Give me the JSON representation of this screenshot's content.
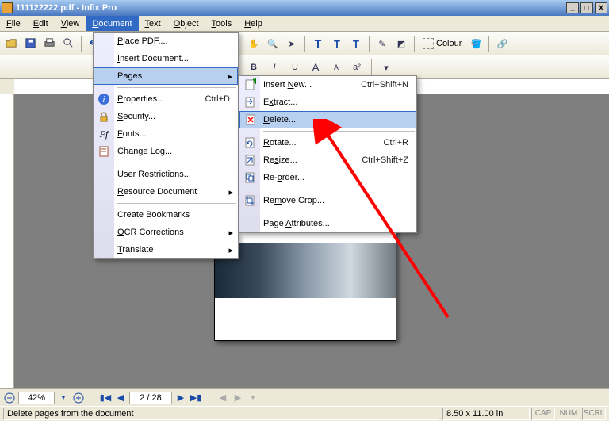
{
  "window": {
    "title": "111122222.pdf - Infix Pro",
    "btn_min": "_",
    "btn_max": "□",
    "btn_close": "X"
  },
  "menubar": [
    "File",
    "Edit",
    "View",
    "Document",
    "Text",
    "Object",
    "Tools",
    "Help"
  ],
  "open_menu_index": 3,
  "toolbar": {
    "colour_label": "Colour"
  },
  "doc_menu": {
    "items": [
      {
        "label": "Place PDF....",
        "u": 0
      },
      {
        "label": "Insert Document...",
        "u": 0
      },
      {
        "label": "Pages",
        "u": -1,
        "sub": true,
        "hl": true
      },
      {
        "div": true
      },
      {
        "label": "Properties...",
        "u": 0,
        "shortcut": "Ctrl+D",
        "icon": "info"
      },
      {
        "label": "Security...",
        "u": 0,
        "icon": "lock"
      },
      {
        "label": "Fonts...",
        "u": 0,
        "icon": "ff"
      },
      {
        "label": "Change Log...",
        "u": 0,
        "icon": "log"
      },
      {
        "div": true
      },
      {
        "label": "User Restrictions...",
        "u": 0
      },
      {
        "label": "Resource Document",
        "u": 0,
        "sub": true
      },
      {
        "div": true
      },
      {
        "label": "Create Bookmarks",
        "u": -1
      },
      {
        "label": "OCR Corrections",
        "u": 0,
        "sub": true
      },
      {
        "label": "Translate",
        "u": 0,
        "sub": true
      }
    ]
  },
  "pages_menu": {
    "items": [
      {
        "label": "Insert New...",
        "u": 7,
        "shortcut": "Ctrl+Shift+N",
        "icon": "pg-add"
      },
      {
        "label": "Extract...",
        "u": 1,
        "icon": "pg-ext"
      },
      {
        "label": "Delete...",
        "u": 0,
        "icon": "pg-del",
        "hl": true
      },
      {
        "div": true
      },
      {
        "label": "Rotate...",
        "u": 0,
        "shortcut": "Ctrl+R",
        "icon": "pg-rot"
      },
      {
        "label": "Resize...",
        "u": 2,
        "shortcut": "Ctrl+Shift+Z",
        "icon": "pg-res"
      },
      {
        "label": "Re-order...",
        "u": 3,
        "icon": "pg-ord"
      },
      {
        "div": true
      },
      {
        "label": "Remove Crop...",
        "u": 2,
        "icon": "pg-crop"
      },
      {
        "div": true
      },
      {
        "label": "Page Attributes...",
        "u": 5
      }
    ]
  },
  "nav": {
    "zoom": "42%",
    "page": "2 / 28"
  },
  "status": {
    "message": "Delete pages from the document",
    "dims": "8.50 x 11.00 in",
    "ind": [
      "CAP",
      "NUM",
      "SCRL"
    ]
  }
}
